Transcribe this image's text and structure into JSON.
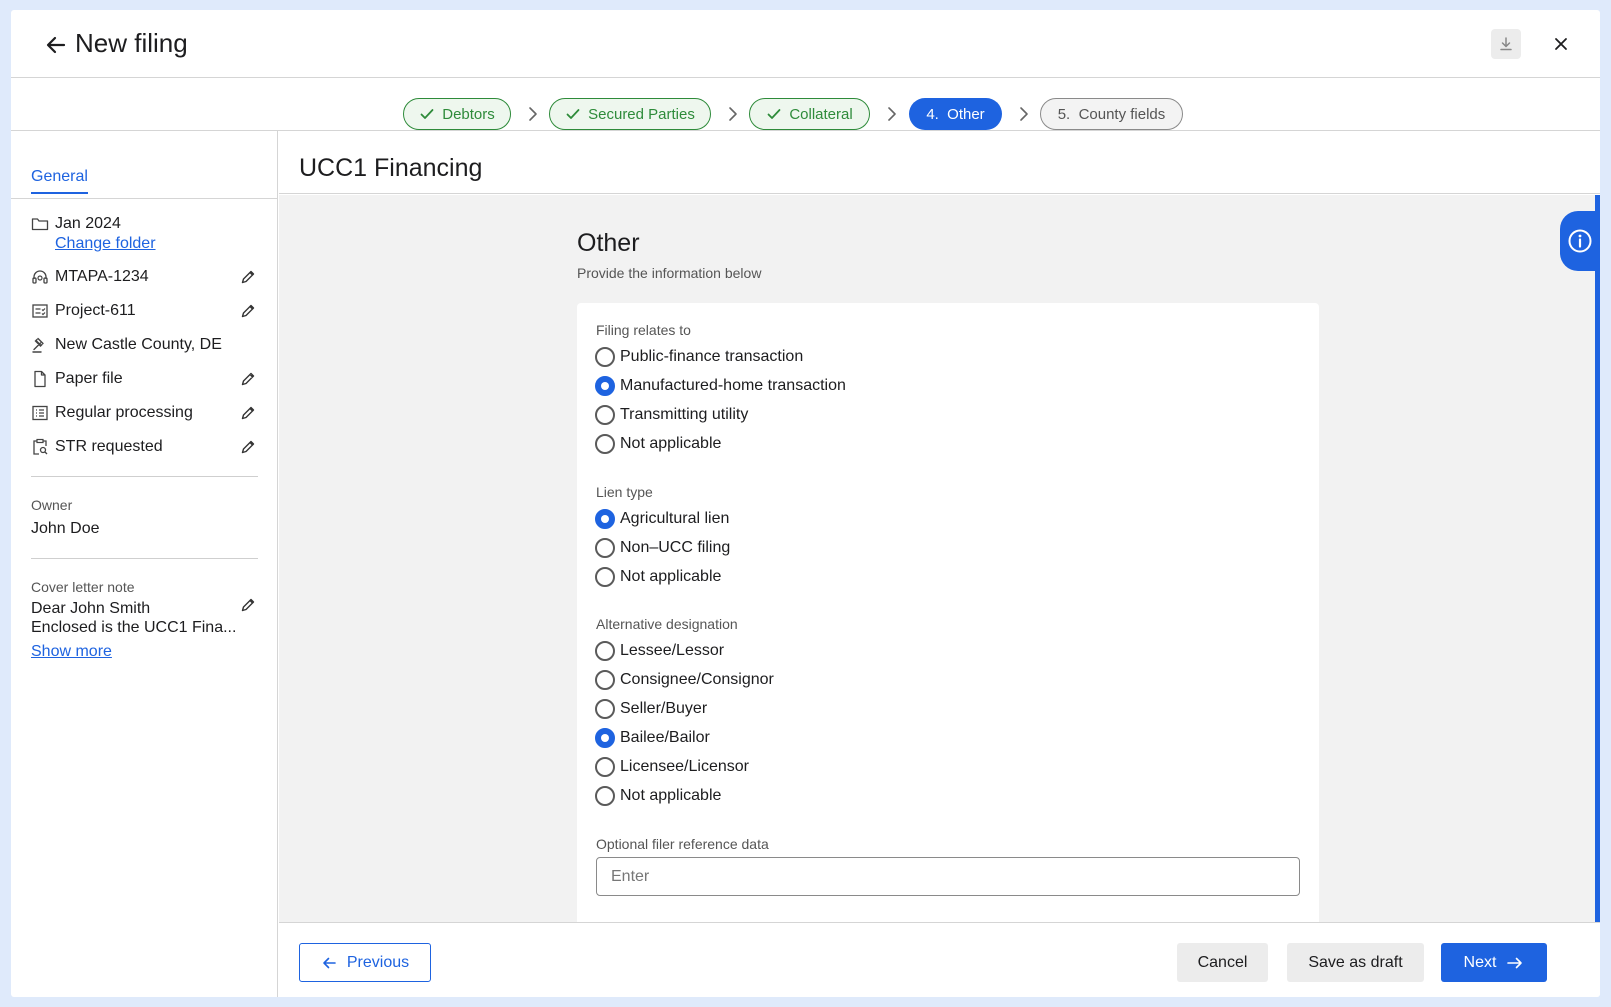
{
  "header": {
    "title": "New filing"
  },
  "stepper": {
    "steps": [
      {
        "label": "Debtors",
        "state": "done"
      },
      {
        "label": "Secured Parties",
        "state": "done"
      },
      {
        "label": "Collateral",
        "state": "done"
      },
      {
        "label": "4.  Other",
        "state": "active"
      },
      {
        "label": "5.  County fields",
        "state": "todo"
      }
    ]
  },
  "sidebar": {
    "tab": "General",
    "folder": "Jan 2024",
    "change_folder": "Change folder",
    "items": [
      {
        "label": "MTAPA-1234",
        "icon": "headset-icon",
        "editable": true
      },
      {
        "label": "Project-611",
        "icon": "checklist-icon",
        "editable": true
      },
      {
        "label": "New Castle County, DE",
        "icon": "gavel-icon",
        "editable": false
      },
      {
        "label": "Paper file",
        "icon": "file-icon",
        "editable": true
      },
      {
        "label": "Regular processing",
        "icon": "list-icon",
        "editable": true
      },
      {
        "label": "STR requested",
        "icon": "clipboard-search-icon",
        "editable": true
      }
    ],
    "owner_label": "Owner",
    "owner_value": "John Doe",
    "cover_label": "Cover letter note",
    "cover_line1": "Dear John Smith",
    "cover_line2": "Enclosed is the UCC1 Fina...",
    "show_more": "Show more"
  },
  "main": {
    "title": "UCC1 Financing",
    "section_title": "Other",
    "section_subtitle": "Provide the information below"
  },
  "form": {
    "filing_relates": {
      "label": "Filing relates to",
      "options": [
        "Public-finance transaction",
        "Manufactured-home transaction",
        "Transmitting utility",
        "Not applicable"
      ],
      "selected": 1
    },
    "lien_type": {
      "label": "Lien type",
      "options": [
        "Agricultural lien",
        "Non–UCC filing",
        "Not applicable"
      ],
      "selected": 0
    },
    "alt_designation": {
      "label": "Alternative designation",
      "options": [
        "Lessee/Lessor",
        "Consignee/Consignor",
        "Seller/Buyer",
        "Bailee/Bailor",
        "Licensee/Licensor",
        "Not applicable"
      ],
      "selected": 3
    },
    "reference": {
      "label": "Optional filer reference data",
      "placeholder": "Enter",
      "value": ""
    }
  },
  "footer": {
    "previous": "Previous",
    "cancel": "Cancel",
    "save_draft": "Save as draft",
    "next": "Next"
  },
  "colors": {
    "accent": "#1e63e0",
    "done": "#2e8b3a",
    "background": "#dfeafb"
  }
}
